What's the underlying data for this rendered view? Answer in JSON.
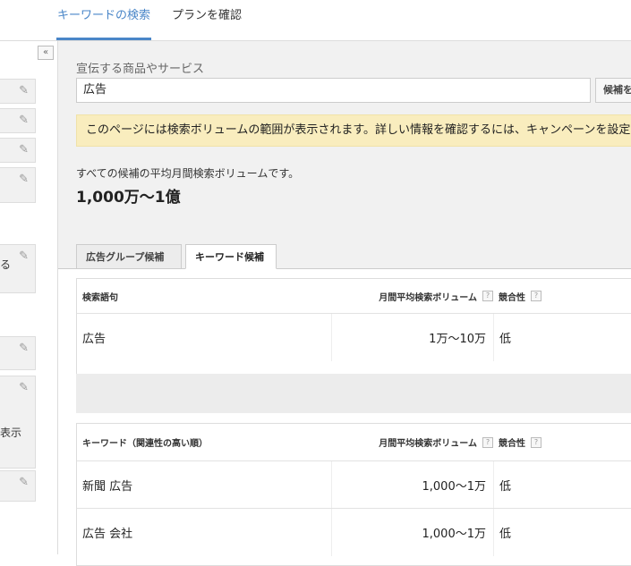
{
  "top_tabs": {
    "search": "キーワードの検索",
    "plan": "プランを確認"
  },
  "sidebar": {
    "collapse_glyph": "«",
    "fragments": [
      "る",
      "表示"
    ]
  },
  "search": {
    "label": "宣伝する商品やサービス",
    "value": "広告",
    "candidate_button": "候補を"
  },
  "notice": "このページには検索ボリュームの範囲が表示されます。詳しい情報を確認するには、キャンペーンを設定して実行し",
  "summary": {
    "label": "すべての候補の平均月間検索ボリュームです。",
    "value": "1,000万～1億"
  },
  "subtabs": {
    "ad_group": "広告グループ候補",
    "keyword": "キーワード候補"
  },
  "search_terms_table": {
    "headers": {
      "term": "検索語句",
      "volume": "月間平均検索ボリューム",
      "competition": "競合性"
    },
    "rows": [
      {
        "term": "広告",
        "volume": "1万～10万",
        "competition": "低"
      }
    ]
  },
  "keywords_table": {
    "headers": {
      "term": "キーワード（関連性の高い順）",
      "volume": "月間平均検索ボリューム",
      "competition": "競合性"
    },
    "rows": [
      {
        "term": "新聞 広告",
        "volume": "1,000～1万",
        "competition": "低"
      },
      {
        "term": "広告 会社",
        "volume": "1,000～1万",
        "competition": "低"
      }
    ]
  },
  "help_glyph": "?",
  "colors": {
    "accent": "#4a86c8",
    "notice_bg": "#f9edbe",
    "panel_bg": "#f1f1f1"
  }
}
